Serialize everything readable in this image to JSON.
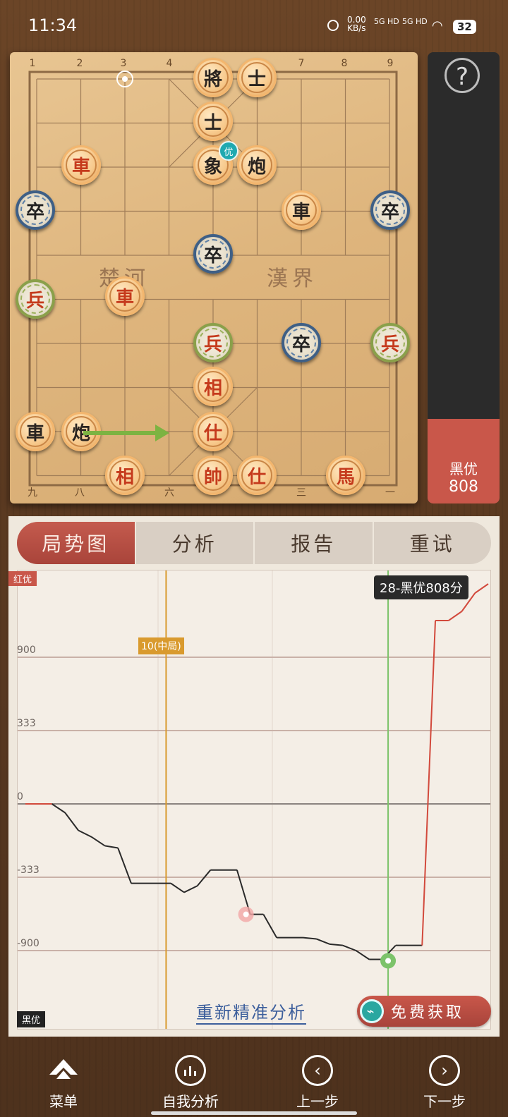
{
  "status": {
    "time": "11:34",
    "net_speed": "0.00",
    "net_unit": "KB/s",
    "sig1": "5G HD",
    "sig2": "5G HD",
    "battery": "32"
  },
  "board": {
    "file_numbers_top": [
      "1",
      "2",
      "3",
      "4",
      "5",
      "6",
      "7",
      "8",
      "9"
    ],
    "file_numbers_bottom": [
      "九",
      "八",
      "七",
      "六",
      "五",
      "四",
      "三",
      "二",
      "一"
    ],
    "river_left": "楚河",
    "river_right": "漢界",
    "best_badge": "优",
    "pieces": [
      {
        "char": "將",
        "style": "orange",
        "text": "blk"
      },
      {
        "char": "士",
        "style": "orange",
        "text": "blk"
      },
      {
        "char": "士",
        "style": "orange",
        "text": "blk"
      },
      {
        "char": "象",
        "style": "orange",
        "text": "blk"
      },
      {
        "char": "炮",
        "style": "orange",
        "text": "blk"
      },
      {
        "char": "車",
        "style": "orange",
        "text": "red"
      },
      {
        "char": "卒",
        "style": "blue",
        "text": "blk"
      },
      {
        "char": "車",
        "style": "orange",
        "text": "blk"
      },
      {
        "char": "卒",
        "style": "blue",
        "text": "blk"
      },
      {
        "char": "卒",
        "style": "blue",
        "text": "blk"
      },
      {
        "char": "兵",
        "style": "green",
        "text": "red"
      },
      {
        "char": "車",
        "style": "orange",
        "text": "red"
      },
      {
        "char": "兵",
        "style": "green",
        "text": "red"
      },
      {
        "char": "卒",
        "style": "blue",
        "text": "blk"
      },
      {
        "char": "兵",
        "style": "green",
        "text": "red"
      },
      {
        "char": "相",
        "style": "orange",
        "text": "red"
      },
      {
        "char": "車",
        "style": "orange",
        "text": "blk"
      },
      {
        "char": "炮",
        "style": "orange",
        "text": "blk"
      },
      {
        "char": "仕",
        "style": "orange",
        "text": "red"
      },
      {
        "char": "相",
        "style": "orange",
        "text": "red"
      },
      {
        "char": "帥",
        "style": "orange",
        "text": "red"
      },
      {
        "char": "仕",
        "style": "orange",
        "text": "red"
      },
      {
        "char": "馬",
        "style": "orange",
        "text": "red"
      }
    ]
  },
  "side": {
    "help_label": "?",
    "eval_side": "黑优",
    "eval_score": "808"
  },
  "tabs": [
    {
      "label": "局势图",
      "active": true
    },
    {
      "label": "分析",
      "active": false
    },
    {
      "label": "报告",
      "active": false
    },
    {
      "label": "重试",
      "active": false
    }
  ],
  "chart_data": {
    "type": "line",
    "title": "",
    "top_tag": "红优",
    "bottom_tag": "黑优",
    "y_ticks": [
      "900",
      "333",
      "0",
      "-333",
      "-900"
    ],
    "y_tick_values": [
      900,
      333,
      0,
      -333,
      -900
    ],
    "marker_midgame": "10(中局)",
    "tooltip": "28-黑优808分",
    "x": [
      0,
      1,
      2,
      3,
      4,
      5,
      6,
      7,
      8,
      9,
      10,
      11,
      12,
      13,
      14,
      15,
      16,
      17,
      18,
      19,
      20,
      21,
      22,
      23,
      24,
      25,
      26,
      27,
      28,
      29,
      30,
      31,
      32,
      33,
      34,
      35
    ],
    "values": [
      0,
      0,
      0,
      -40,
      -120,
      -150,
      -190,
      -200,
      -380,
      -380,
      -380,
      -380,
      -450,
      -400,
      -300,
      -300,
      -300,
      -620,
      -620,
      -800,
      -800,
      -800,
      -810,
      -850,
      -860,
      -900,
      -950,
      -950,
      -860,
      -860,
      -860,
      1100,
      1100,
      1150,
      1250,
      1300
    ],
    "colors": {
      "red": "#d2493c",
      "black": "#2a2a2a",
      "midgame": "#d99a2e",
      "current": "#7cc36a",
      "grid": "#c9b1a8"
    }
  },
  "actions": {
    "reanalyze": "重新精准分析",
    "free_get": "免费获取"
  },
  "nav": [
    {
      "label": "菜单",
      "icon": "menu-icon"
    },
    {
      "label": "自我分析",
      "icon": "self-analysis-icon"
    },
    {
      "label": "上一步",
      "icon": "prev-icon"
    },
    {
      "label": "下一步",
      "icon": "next-icon"
    }
  ]
}
